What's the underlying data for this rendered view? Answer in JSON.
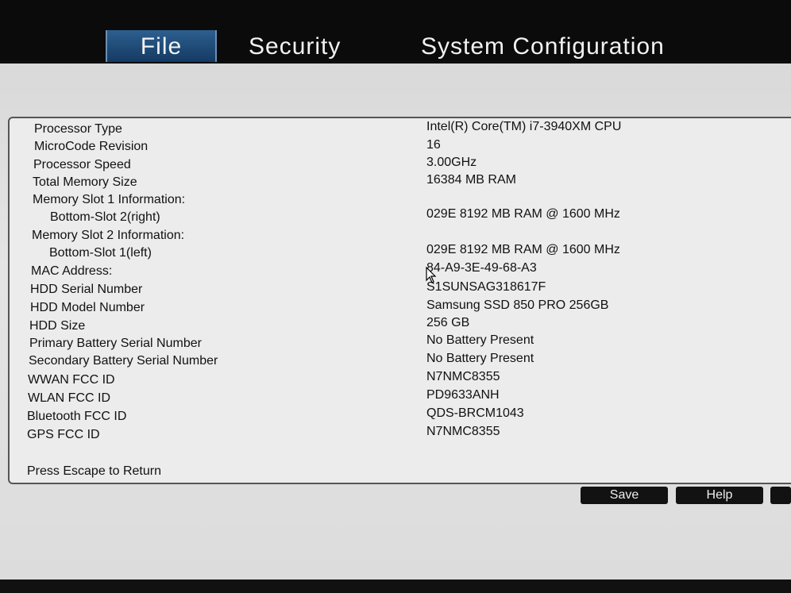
{
  "tabs": [
    {
      "label": "File",
      "active": true
    },
    {
      "label": "Security",
      "active": false
    },
    {
      "label": "System Configuration",
      "active": false
    }
  ],
  "rows": [
    {
      "label": "Processor Type",
      "value": "Intel(R) Core(TM) i7-3940XM CPU"
    },
    {
      "label": "MicroCode Revision",
      "value": "16"
    },
    {
      "label": "Processor Speed",
      "value": "3.00GHz"
    },
    {
      "label": "Total Memory Size",
      "value": "16384 MB RAM"
    },
    {
      "label": "Memory Slot 1 Information:",
      "value": ""
    },
    {
      "label": "Bottom-Slot 2(right)",
      "value": "029E 8192 MB RAM @ 1600 MHz"
    },
    {
      "label": "Memory Slot 2 Information:",
      "value": ""
    },
    {
      "label": "Bottom-Slot 1(left)",
      "value": "029E 8192 MB RAM @ 1600 MHz"
    },
    {
      "label": "MAC Address:",
      "value": "84-A9-3E-49-68-A3"
    },
    {
      "label": "HDD Serial Number",
      "value": "S1SUNSAG318617F"
    },
    {
      "label": "HDD Model Number",
      "value": "Samsung SSD 850 PRO 256GB"
    },
    {
      "label": "HDD Size",
      "value": "256 GB"
    },
    {
      "label": "Primary Battery Serial Number",
      "value": "No Battery Present"
    },
    {
      "label": "Secondary Battery Serial Number",
      "value": "No Battery Present"
    },
    {
      "label": "WWAN FCC ID",
      "value": "N7NMC8355"
    },
    {
      "label": "WLAN FCC ID",
      "value": "PD9633ANH"
    },
    {
      "label": "Bluetooth FCC ID",
      "value": "QDS-BRCM1043"
    },
    {
      "label": "GPS FCC ID",
      "value": "N7NMC8355"
    }
  ],
  "footer": {
    "hint": "Press Escape to Return"
  },
  "buttons": {
    "save": "Save",
    "help": "Help"
  }
}
